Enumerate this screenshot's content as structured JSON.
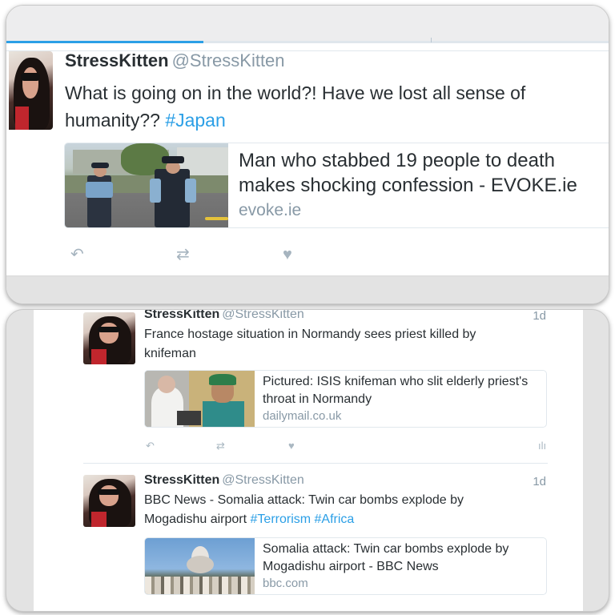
{
  "top_tweet": {
    "name": "StressKitten",
    "handle": "@StressKitten",
    "text_before": "What is going on in the world?! Have we lost all sense of humanity?? ",
    "hashtag": "#Japan",
    "card": {
      "title_line1": "Man who stabbed 19 people to death",
      "title_line2": "makes shocking confession - EVOKE.ie",
      "domain": "evoke.ie"
    },
    "actions": {
      "reply": "↶",
      "retweet": "⇄",
      "like": "♥"
    }
  },
  "tweets": [
    {
      "name": "StressKitten",
      "handle": "@StressKitten",
      "time": "1d",
      "text": "France hostage situation in Normandy sees priest killed by knifeman",
      "card": {
        "title": "Pictured: ISIS knifeman who slit elderly priest's throat in Normandy",
        "domain": "dailymail.co.uk"
      },
      "actions": {
        "reply": "↶",
        "retweet": "⇄",
        "like": "♥",
        "stats": "ılı"
      }
    },
    {
      "name": "StressKitten",
      "handle": "@StressKitten",
      "time": "1d",
      "text_before": "BBC News - Somalia attack: Twin car bombs explode by Mogadishu airport ",
      "hashtag1": "#Terrorism",
      "hashtag2": "#Africa",
      "card": {
        "title": "Somalia attack: Twin car bombs explode by Mogadishu airport - BBC News",
        "domain": "bbc.com"
      }
    }
  ],
  "colors": {
    "link": "#2b9fe6",
    "name": "#292f33",
    "secondary": "#8899a6",
    "action": "#a6b4bf"
  }
}
